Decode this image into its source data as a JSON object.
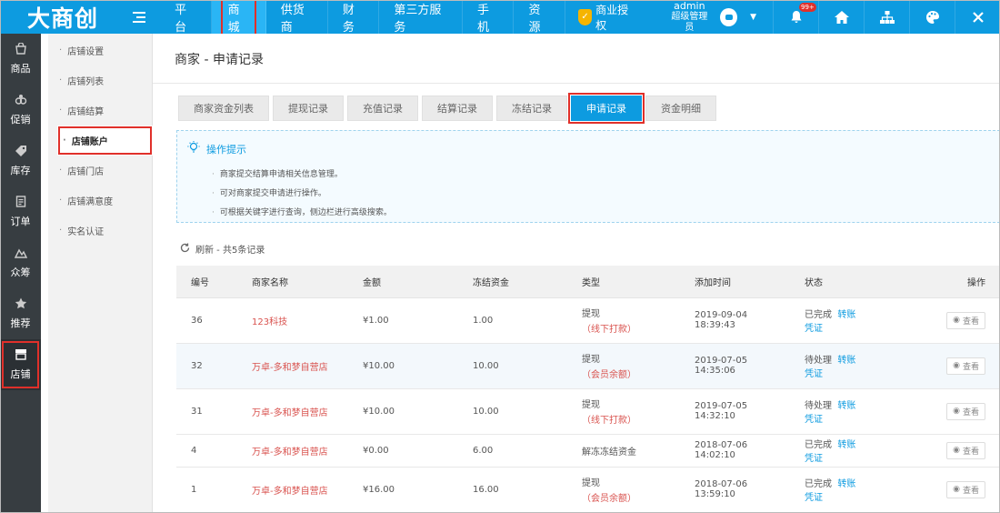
{
  "topbar": {
    "logo": "大商创",
    "nav": [
      "平台",
      "商城",
      "供货商",
      "财务",
      "第三方服务",
      "手机",
      "资源"
    ],
    "active_nav": 1,
    "auth_label": "商业授权",
    "auth_icon": "shield-check-icon",
    "user_name": "admin",
    "user_role": "超级管理员",
    "notification_badge": "99+",
    "icons": [
      "bell-icon",
      "home-icon",
      "sitemap-icon",
      "palette-icon",
      "close-icon"
    ],
    "accent_color": "#0d9be0"
  },
  "sidebar": {
    "items": [
      {
        "label": "商品",
        "icon": "goods-icon"
      },
      {
        "label": "促销",
        "icon": "promotion-icon"
      },
      {
        "label": "库存",
        "icon": "tag-icon"
      },
      {
        "label": "订单",
        "icon": "order-icon"
      },
      {
        "label": "众筹",
        "icon": "crowdfund-icon"
      },
      {
        "label": "推荐",
        "icon": "star-icon"
      },
      {
        "label": "店铺",
        "icon": "store-icon"
      }
    ],
    "active": 6
  },
  "submenu": {
    "items": [
      "店铺设置",
      "店铺列表",
      "店铺结算",
      "店铺账户",
      "店铺门店",
      "店铺满意度",
      "实名认证"
    ],
    "active": 3
  },
  "page": {
    "title": "商家 - 申请记录",
    "tabs": [
      "商家资金列表",
      "提现记录",
      "充值记录",
      "结算记录",
      "冻结记录",
      "申请记录",
      "资金明细"
    ],
    "active_tab": 5
  },
  "tips": {
    "title": "操作提示",
    "items": [
      "商家提交结算申请相关信息管理。",
      "可对商家提交申请进行操作。",
      "可根据关键字进行查询，侧边栏进行高级搜索。"
    ]
  },
  "refresh_text": "刷新 - 共5条记录",
  "table": {
    "headers": [
      "编号",
      "商家名称",
      "金额",
      "冻结资金",
      "类型",
      "添加时间",
      "状态",
      "操作"
    ],
    "rows": [
      {
        "id": "36",
        "name": "123科技",
        "amount": "¥1.00",
        "frozen": "1.00",
        "type": "提现",
        "type_sub": "（线下打款）",
        "time": "2019-09-04 18:39:43",
        "status": "已完成",
        "link": "转账凭证",
        "action": "查看"
      },
      {
        "id": "32",
        "name": "万卓-多和梦自营店",
        "amount": "¥10.00",
        "frozen": "10.00",
        "type": "提现",
        "type_sub": "（会员余额）",
        "time": "2019-07-05 14:35:06",
        "status": "待处理",
        "link": "转账凭证",
        "action": "查看"
      },
      {
        "id": "31",
        "name": "万卓-多和梦自营店",
        "amount": "¥10.00",
        "frozen": "10.00",
        "type": "提现",
        "type_sub": "（线下打款）",
        "time": "2019-07-05 14:32:10",
        "status": "待处理",
        "link": "转账凭证",
        "action": "查看"
      },
      {
        "id": "4",
        "name": "万卓-多和梦自营店",
        "amount": "¥0.00",
        "frozen": "6.00",
        "type": "解冻冻结资金",
        "type_sub": "",
        "time": "2018-07-06 14:02:10",
        "status": "已完成",
        "link": "转账凭证",
        "action": "查看"
      },
      {
        "id": "1",
        "name": "万卓-多和梦自营店",
        "amount": "¥16.00",
        "frozen": "16.00",
        "type": "提现",
        "type_sub": "（会员余额）",
        "time": "2018-07-06 13:59:10",
        "status": "已完成",
        "link": "转账凭证",
        "action": "查看"
      }
    ]
  }
}
